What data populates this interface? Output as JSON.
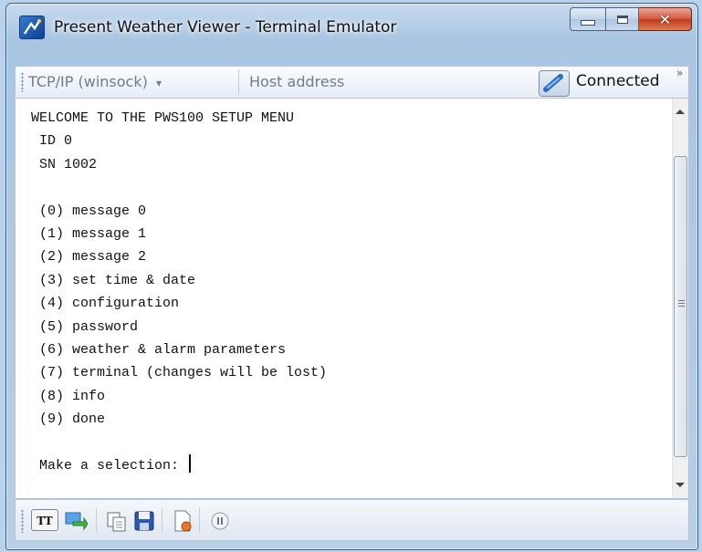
{
  "window": {
    "title": "Present Weather Viewer - Terminal Emulator"
  },
  "toolbar": {
    "protocol": "TCP/IP (winsock)",
    "protocol_arrow": "▾",
    "host_placeholder": "Host address",
    "connection_status": "Connected",
    "overflow": "»"
  },
  "terminal": {
    "lines": [
      "WELCOME TO THE PWS100 SETUP MENU",
      " ID 0",
      " SN 1002",
      "",
      " (0) message 0",
      " (1) message 1",
      " (2) message 2",
      " (3) set time & date",
      " (4) configuration",
      " (5) password",
      " (6) weather & alarm parameters",
      " (7) terminal (changes will be lost)",
      " (8) info",
      " (9) done",
      "",
      " Make a selection: "
    ]
  },
  "statusbar": {
    "tt_label": "TT"
  },
  "colors": {
    "window_frame": "#a9c5e2",
    "close_button": "#c23a1c",
    "terminal_bg": "#ffffff"
  }
}
